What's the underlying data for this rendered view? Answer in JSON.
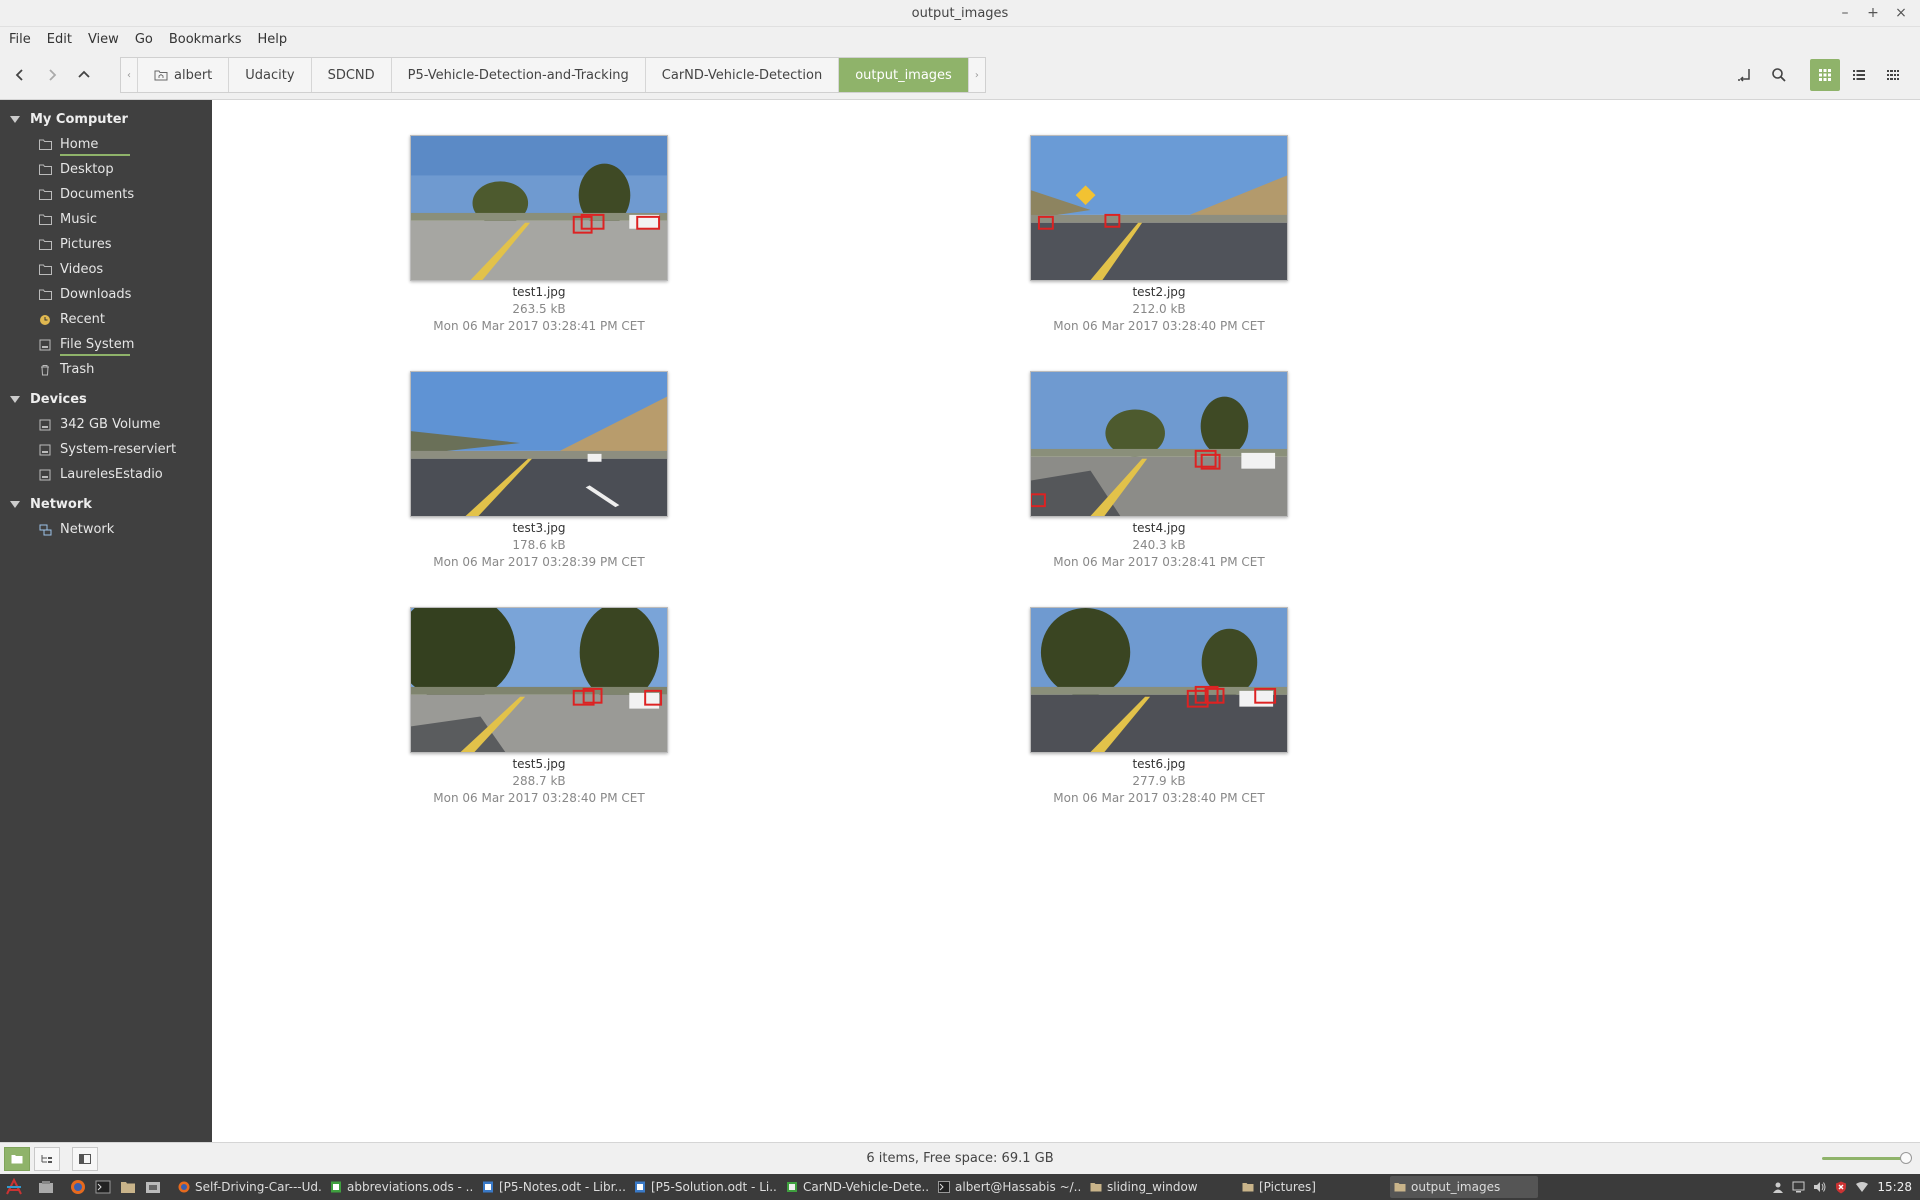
{
  "window": {
    "title": "output_images"
  },
  "menu": [
    "File",
    "Edit",
    "View",
    "Go",
    "Bookmarks",
    "Help"
  ],
  "breadcrumb": [
    "albert",
    "Udacity",
    "SDCND",
    "P5-Vehicle-Detection-and-Tracking",
    "CarND-Vehicle-Detection",
    "output_images"
  ],
  "sidebar": {
    "sections": [
      {
        "title": "My Computer",
        "items": [
          "Home",
          "Desktop",
          "Documents",
          "Music",
          "Pictures",
          "Videos",
          "Downloads",
          "Recent",
          "File System",
          "Trash"
        ]
      },
      {
        "title": "Devices",
        "items": [
          "342 GB Volume",
          "System-reserviert",
          "LaurelesEstadio"
        ]
      },
      {
        "title": "Network",
        "items": [
          "Network"
        ]
      }
    ]
  },
  "files": [
    {
      "name": "test1.jpg",
      "size": "263.5 kB",
      "date": "Mon 06 Mar 2017 03:28:41 PM CET"
    },
    {
      "name": "test2.jpg",
      "size": "212.0 kB",
      "date": "Mon 06 Mar 2017 03:28:40 PM CET"
    },
    {
      "name": "test3.jpg",
      "size": "178.6 kB",
      "date": "Mon 06 Mar 2017 03:28:39 PM CET"
    },
    {
      "name": "test4.jpg",
      "size": "240.3 kB",
      "date": "Mon 06 Mar 2017 03:28:41 PM CET"
    },
    {
      "name": "test5.jpg",
      "size": "288.7 kB",
      "date": "Mon 06 Mar 2017 03:28:40 PM CET"
    },
    {
      "name": "test6.jpg",
      "size": "277.9 kB",
      "date": "Mon 06 Mar 2017 03:28:40 PM CET"
    }
  ],
  "status": {
    "text": "6 items, Free space: 69.1 GB",
    "zoom_level": 1.0
  },
  "taskbar": {
    "windows": [
      "Self-Driving-Car---Ud...",
      "abbreviations.ods - ...",
      "[P5-Notes.odt - Libr...",
      "[P5-Solution.odt - Li...",
      "CarND-Vehicle-Dete...",
      "albert@Hassabis ~/...",
      "sliding_window",
      "[Pictures]",
      "output_images"
    ],
    "clock": "15:28"
  },
  "colors": {
    "accent": "#8fb36a",
    "sidebar_bg": "#404040",
    "taskbar_bg": "#3b3b3b"
  }
}
